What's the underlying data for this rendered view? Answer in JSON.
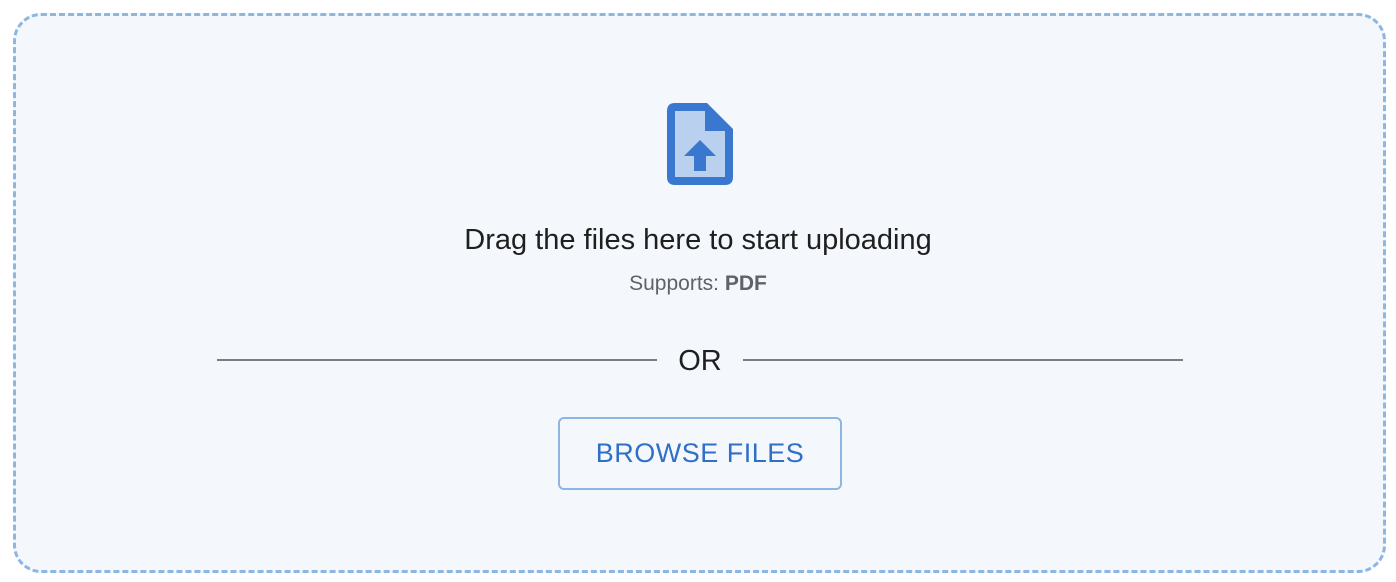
{
  "upload": {
    "title": "Drag the files here to start uploading",
    "supports_label": "Supports:",
    "supports_format": "PDF",
    "or_text": "OR",
    "browse_label": "BROWSE FILES",
    "icon": "file-upload-icon"
  },
  "colors": {
    "accent": "#2f6fc7",
    "icon_dark": "#3a78cf",
    "icon_light": "#b9d0ef",
    "border": "#8db6e2",
    "background": "#f4f8fc"
  }
}
